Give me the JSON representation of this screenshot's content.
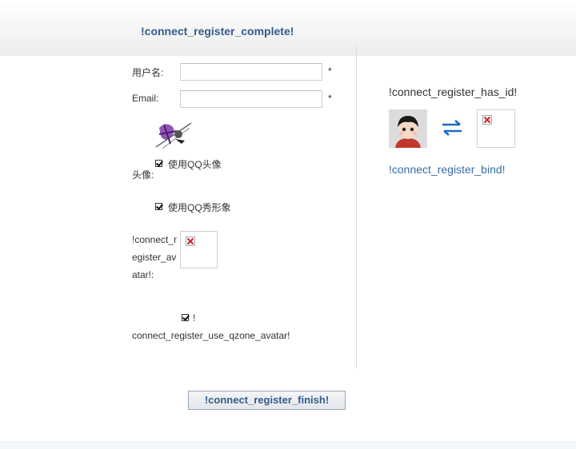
{
  "header": {
    "title": "!connect_register_complete!"
  },
  "form": {
    "username_label": "用户名:",
    "email_label": "Email:",
    "required_mark": "*",
    "avatar_label": "头像:",
    "use_qq_avatar_label": "使用QQ头像",
    "use_qq_show_label": "使用QQ秀形象",
    "register_avatar_label": "!connect_register_avatar!:",
    "use_qzone_avatar_mark": "!",
    "use_qzone_avatar_label": "connect_register_use_qzone_avatar!",
    "finish_button": "!connect_register_finish!"
  },
  "side": {
    "has_id_text": "!connect_register_has_id!",
    "bind_link": "!connect_register_bind!"
  },
  "colors": {
    "accent": "#335a8c",
    "link": "#3a6ea5",
    "arrows": "#1f6bc4"
  }
}
